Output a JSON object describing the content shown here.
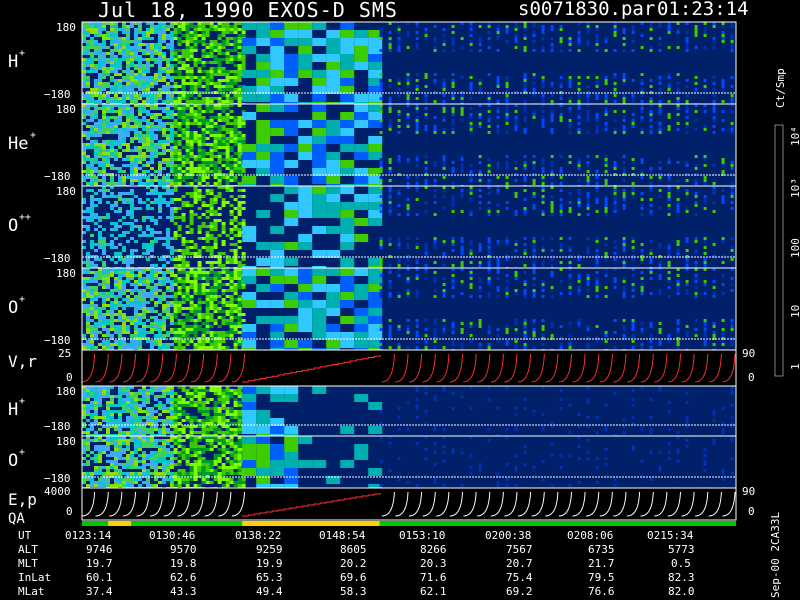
{
  "header": {
    "title": "Jul 18, 1990   EXOS-D SMS",
    "file": "s0071830.par",
    "time": "01:23:14"
  },
  "colorbar": {
    "unit": "Ct/Smp",
    "ticks": [
      "10⁴",
      "10³",
      "100",
      "10",
      "1"
    ],
    "colors": [
      "#ffffff",
      "#7a0000",
      "#c80000",
      "#ff2a00",
      "#8a5a00",
      "#6b8c00",
      "#a0a000",
      "#ffff00",
      "#80ff00",
      "#3ccc00",
      "#009a2a",
      "#00b0b0",
      "#30c8ff",
      "#0060ff",
      "#0000c8",
      "#00006a"
    ]
  },
  "chart_data": {
    "type": "heatmap",
    "panels": [
      {
        "label_main": "H",
        "label_sup": "+",
        "ytop": "180",
        "ybot": "−180"
      },
      {
        "label_main": "He",
        "label_sup": "+",
        "ytop": "180",
        "ybot": "−180"
      },
      {
        "label_main": "O",
        "label_sup": "++",
        "ytop": "180",
        "ybot": "−180"
      },
      {
        "label_main": "O",
        "label_sup": "+",
        "ytop": "180",
        "ybot": "−180"
      },
      {
        "label_main": "V,r",
        "label_sup": "",
        "ytop": "25",
        "ybot": "0",
        "right_top": "90",
        "right_bot": "0"
      },
      {
        "label_main": "H",
        "label_sup": "+",
        "ytop": "180",
        "ybot": "−180"
      },
      {
        "label_main": "O",
        "label_sup": "+",
        "ytop": "180",
        "ybot": "−180"
      },
      {
        "label_main": "E,p",
        "label_sup": "",
        "ytop": "4000",
        "ybot": "0",
        "right_top": "90",
        "right_bot": "0"
      }
    ],
    "qa_label": "QA",
    "ephemeris": {
      "labels": [
        "UT",
        "ALT",
        "MLT",
        "InLat",
        "MLat"
      ],
      "rows": [
        [
          "0123:14",
          "0130:46",
          "0138:22",
          "0148:54",
          "0153:10",
          "0200:38",
          "0208:06",
          "0215:34"
        ],
        [
          "9746",
          "9570",
          "9259",
          "8605",
          "8266",
          "7567",
          "6735",
          "5773"
        ],
        [
          "19.7",
          "19.8",
          "19.9",
          "20.2",
          "20.3",
          "20.7",
          "21.7",
          "0.5"
        ],
        [
          "60.1",
          "62.6",
          "65.3",
          "69.6",
          "71.6",
          "75.4",
          "79.5",
          "82.3"
        ],
        [
          "37.4",
          "43.3",
          "49.4",
          "58.3",
          "62.1",
          "69.2",
          "76.6",
          "82.0"
        ]
      ]
    }
  },
  "footer_id": "Sep-00 2CA33L"
}
